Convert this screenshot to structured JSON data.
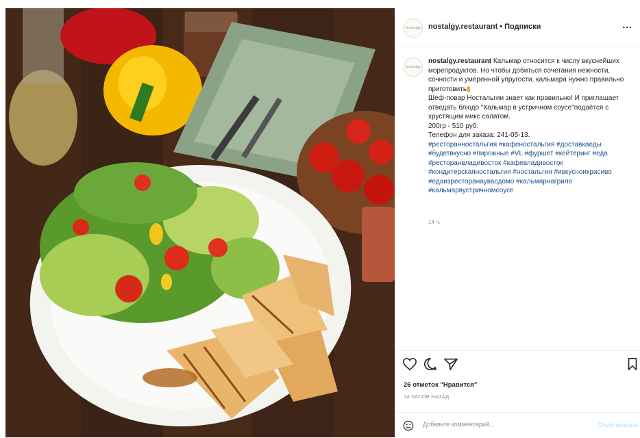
{
  "post": {
    "username": "nostalgy.restaurant",
    "separator": "•",
    "follow_label": "Подписки",
    "more_label": "...",
    "avatar_text": "Nostalgy",
    "caption": {
      "intro": "Кальмар относится к числу вкуснейших морепродуктов. Но чтобы добиться сочетания нежности, сочности и умеренной упругости, кальмара нужно правильно приготовить",
      "line2": "Шеф-повар Ностальгии знает как правильно! И приглашает отведать блюдо \"Кальмар в устричном соусе\"подаётся с хрустящим микс салатом.",
      "price": "200гр - 510 руб.",
      "phone": "Телефон для заказа: 241-05-13.",
      "hashtags": "#ресторанностальгия #кафеностальгия #доставкаеды #будетвкусно #пирожные #VL #фуршет #кейтеринг #еда #ресторанвладивосток #кафевладивосток #кондитерскаяностальгия #ностальгия #ивкусноикрасиво #едаизресторанаувасдомо #кальмарнагриле #кальмарвустричномсоусе"
    },
    "caption_time": "14 ч.",
    "likes_text": "26 отметок \"Нравится\"",
    "posted_ago": "14 ЧАСОВ НАЗАД",
    "comment_placeholder": "Добавьте комментарий...",
    "publish_label": "Опубликовать",
    "icons": [
      "heart-icon",
      "comment-icon",
      "share-icon",
      "bookmark-icon",
      "emoji-icon"
    ]
  }
}
